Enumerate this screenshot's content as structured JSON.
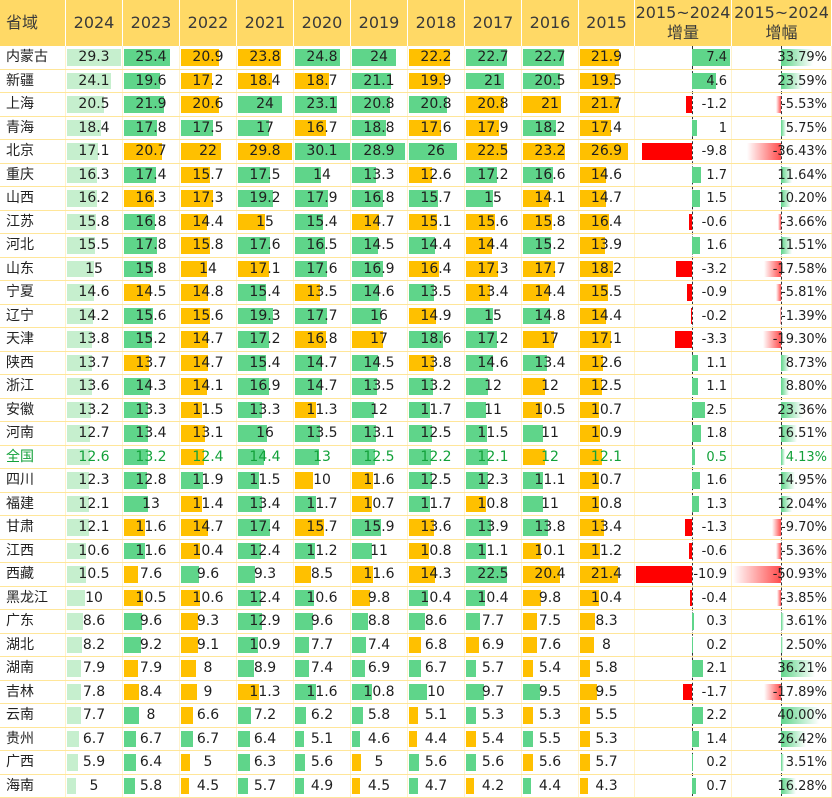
{
  "chart_data": {
    "type": "table",
    "columns": [
      "省域",
      "2024",
      "2023",
      "2022",
      "2021",
      "2020",
      "2019",
      "2018",
      "2017",
      "2016",
      "2015",
      "2015~2024|增量",
      "2015~2024|增幅"
    ],
    "rows": [
      {
        "name": "内蒙古",
        "values": [
          "29.3",
          "25.4",
          "20.9",
          "23.8",
          "24.8",
          "24",
          "22.2",
          "22.7",
          "22.7",
          "21.9"
        ],
        "delta": "7.4",
        "pct": "33.79%"
      },
      {
        "name": "新疆",
        "values": [
          "24.1",
          "19.6",
          "17.2",
          "18.4",
          "18.7",
          "21.1",
          "19.9",
          "21",
          "20.5",
          "19.5"
        ],
        "delta": "4.6",
        "pct": "23.59%"
      },
      {
        "name": "上海",
        "values": [
          "20.5",
          "21.9",
          "20.6",
          "24",
          "23.1",
          "20.8",
          "20.8",
          "20.8",
          "21",
          "21.7"
        ],
        "delta": "-1.2",
        "pct": "-5.53%"
      },
      {
        "name": "青海",
        "values": [
          "18.4",
          "17.8",
          "17.5",
          "17",
          "16.7",
          "18.8",
          "17.6",
          "17.9",
          "18.2",
          "17.4"
        ],
        "delta": "1",
        "pct": "5.75%"
      },
      {
        "name": "北京",
        "values": [
          "17.1",
          "20.7",
          "22",
          "29.8",
          "30.1",
          "28.9",
          "26",
          "22.5",
          "23.2",
          "26.9"
        ],
        "delta": "-9.8",
        "pct": "-36.43%"
      },
      {
        "name": "重庆",
        "values": [
          "16.3",
          "17.4",
          "15.7",
          "17.5",
          "14",
          "13.3",
          "12.6",
          "17.2",
          "16.6",
          "14.6"
        ],
        "delta": "1.7",
        "pct": "11.64%"
      },
      {
        "name": "山西",
        "values": [
          "16.2",
          "16.3",
          "17.3",
          "19.2",
          "17.9",
          "16.8",
          "15.7",
          "15",
          "14.1",
          "14.7"
        ],
        "delta": "1.5",
        "pct": "10.20%"
      },
      {
        "name": "江苏",
        "values": [
          "15.8",
          "16.8",
          "14.4",
          "15",
          "15.4",
          "14.7",
          "15.1",
          "15.6",
          "15.8",
          "16.4"
        ],
        "delta": "-0.6",
        "pct": "-3.66%"
      },
      {
        "name": "河北",
        "values": [
          "15.5",
          "17.8",
          "15.8",
          "17.6",
          "16.5",
          "14.5",
          "14.4",
          "14.4",
          "15.2",
          "13.9"
        ],
        "delta": "1.6",
        "pct": "11.51%"
      },
      {
        "name": "山东",
        "values": [
          "15",
          "15.8",
          "14",
          "17.1",
          "17.6",
          "16.9",
          "16.4",
          "17.3",
          "17.7",
          "18.2"
        ],
        "delta": "-3.2",
        "pct": "-17.58%"
      },
      {
        "name": "宁夏",
        "values": [
          "14.6",
          "14.5",
          "14.8",
          "15.4",
          "13.5",
          "14.6",
          "13.5",
          "13.4",
          "14.4",
          "15.5"
        ],
        "delta": "-0.9",
        "pct": "-5.81%"
      },
      {
        "name": "辽宁",
        "values": [
          "14.2",
          "15.6",
          "15.6",
          "19.3",
          "17.7",
          "16",
          "14.9",
          "15",
          "14.8",
          "14.4"
        ],
        "delta": "-0.2",
        "pct": "-1.39%"
      },
      {
        "name": "天津",
        "values": [
          "13.8",
          "15.2",
          "14.7",
          "17.2",
          "16.8",
          "17",
          "18.6",
          "17.2",
          "17",
          "17.1"
        ],
        "delta": "-3.3",
        "pct": "-19.30%"
      },
      {
        "name": "陕西",
        "values": [
          "13.7",
          "13.7",
          "14.7",
          "15.4",
          "14.7",
          "14.5",
          "13.8",
          "14.6",
          "13.4",
          "12.6"
        ],
        "delta": "1.1",
        "pct": "8.73%"
      },
      {
        "name": "浙江",
        "values": [
          "13.6",
          "14.3",
          "14.1",
          "16.9",
          "14.7",
          "13.5",
          "13.2",
          "12",
          "12",
          "12.5"
        ],
        "delta": "1.1",
        "pct": "8.80%"
      },
      {
        "name": "安徽",
        "values": [
          "13.2",
          "13.3",
          "11.5",
          "13.3",
          "11.3",
          "12",
          "11.7",
          "11",
          "10.5",
          "10.7"
        ],
        "delta": "2.5",
        "pct": "23.36%"
      },
      {
        "name": "河南",
        "values": [
          "12.7",
          "13.4",
          "13.1",
          "16",
          "13.5",
          "13.1",
          "12.5",
          "11.5",
          "11",
          "10.9"
        ],
        "delta": "1.8",
        "pct": "16.51%"
      },
      {
        "name": "全国",
        "values": [
          "12.6",
          "13.2",
          "12.4",
          "14.4",
          "13",
          "12.5",
          "12.2",
          "12.1",
          "12",
          "12.1"
        ],
        "delta": "0.5",
        "pct": "4.13%",
        "national": true
      },
      {
        "name": "四川",
        "values": [
          "12.3",
          "12.8",
          "11.9",
          "11.5",
          "10",
          "11.6",
          "12.5",
          "12.3",
          "11.1",
          "10.7"
        ],
        "delta": "1.6",
        "pct": "14.95%"
      },
      {
        "name": "福建",
        "values": [
          "12.1",
          "13",
          "11.4",
          "13.4",
          "11.7",
          "10.7",
          "11.7",
          "10.8",
          "11",
          "10.8"
        ],
        "delta": "1.3",
        "pct": "12.04%"
      },
      {
        "name": "甘肃",
        "values": [
          "12.1",
          "11.6",
          "14.7",
          "17.4",
          "15.7",
          "15.9",
          "13.6",
          "13.9",
          "13.8",
          "13.4"
        ],
        "delta": "-1.3",
        "pct": "-9.70%"
      },
      {
        "name": "江西",
        "values": [
          "10.6",
          "11.6",
          "10.4",
          "12.4",
          "11.2",
          "11",
          "10.8",
          "11.1",
          "10.1",
          "11.2"
        ],
        "delta": "-0.6",
        "pct": "-5.36%"
      },
      {
        "name": "西藏",
        "values": [
          "10.5",
          "7.6",
          "9.6",
          "9.3",
          "8.5",
          "11.6",
          "14.3",
          "22.5",
          "20.4",
          "21.4"
        ],
        "delta": "-10.9",
        "pct": "-50.93%"
      },
      {
        "name": "黑龙江",
        "values": [
          "10",
          "10.5",
          "10.6",
          "12.4",
          "10.6",
          "9.8",
          "10.4",
          "10.4",
          "9.8",
          "10.4"
        ],
        "delta": "-0.4",
        "pct": "-3.85%"
      },
      {
        "name": "广东",
        "values": [
          "8.6",
          "9.6",
          "9.3",
          "12.9",
          "9.6",
          "8.8",
          "8.6",
          "7.7",
          "7.5",
          "8.3"
        ],
        "delta": "0.3",
        "pct": "3.61%"
      },
      {
        "name": "湖北",
        "values": [
          "8.2",
          "9.2",
          "9.1",
          "10.9",
          "7.7",
          "7.4",
          "6.8",
          "6.9",
          "7.6",
          "8"
        ],
        "delta": "0.2",
        "pct": "2.50%"
      },
      {
        "name": "湖南",
        "values": [
          "7.9",
          "7.9",
          "8",
          "8.9",
          "7.4",
          "6.9",
          "6.7",
          "5.7",
          "5.4",
          "5.8"
        ],
        "delta": "2.1",
        "pct": "36.21%"
      },
      {
        "name": "吉林",
        "values": [
          "7.8",
          "8.4",
          "9",
          "11.3",
          "11.6",
          "10.8",
          "10",
          "9.7",
          "9.5",
          "9.5"
        ],
        "delta": "-1.7",
        "pct": "-17.89%"
      },
      {
        "name": "云南",
        "values": [
          "7.7",
          "8",
          "6.6",
          "7.2",
          "6.2",
          "5.8",
          "5.1",
          "5.3",
          "5.3",
          "5.5"
        ],
        "delta": "2.2",
        "pct": "40.00%"
      },
      {
        "name": "贵州",
        "values": [
          "6.7",
          "6.7",
          "6.7",
          "6.4",
          "5.1",
          "4.6",
          "4.4",
          "5.4",
          "5.5",
          "5.3"
        ],
        "delta": "1.4",
        "pct": "26.42%"
      },
      {
        "name": "广西",
        "values": [
          "5.9",
          "6.4",
          "5",
          "6.3",
          "5.6",
          "5",
          "5.6",
          "5.6",
          "5.6",
          "5.7"
        ],
        "delta": "0.2",
        "pct": "3.51%"
      },
      {
        "name": "海南",
        "values": [
          "5",
          "5.8",
          "4.5",
          "5.7",
          "4.9",
          "4.5",
          "4.7",
          "4.2",
          "4.4",
          "4.3"
        ],
        "delta": "0.7",
        "pct": "16.28%"
      }
    ],
    "colors": {
      "header": "#ffd966",
      "up": "#5fd58a",
      "up_light": "#c6efce",
      "down": "#ffc000",
      "neg": "#ff0000",
      "pct_neg": "#ff4d4d"
    }
  }
}
